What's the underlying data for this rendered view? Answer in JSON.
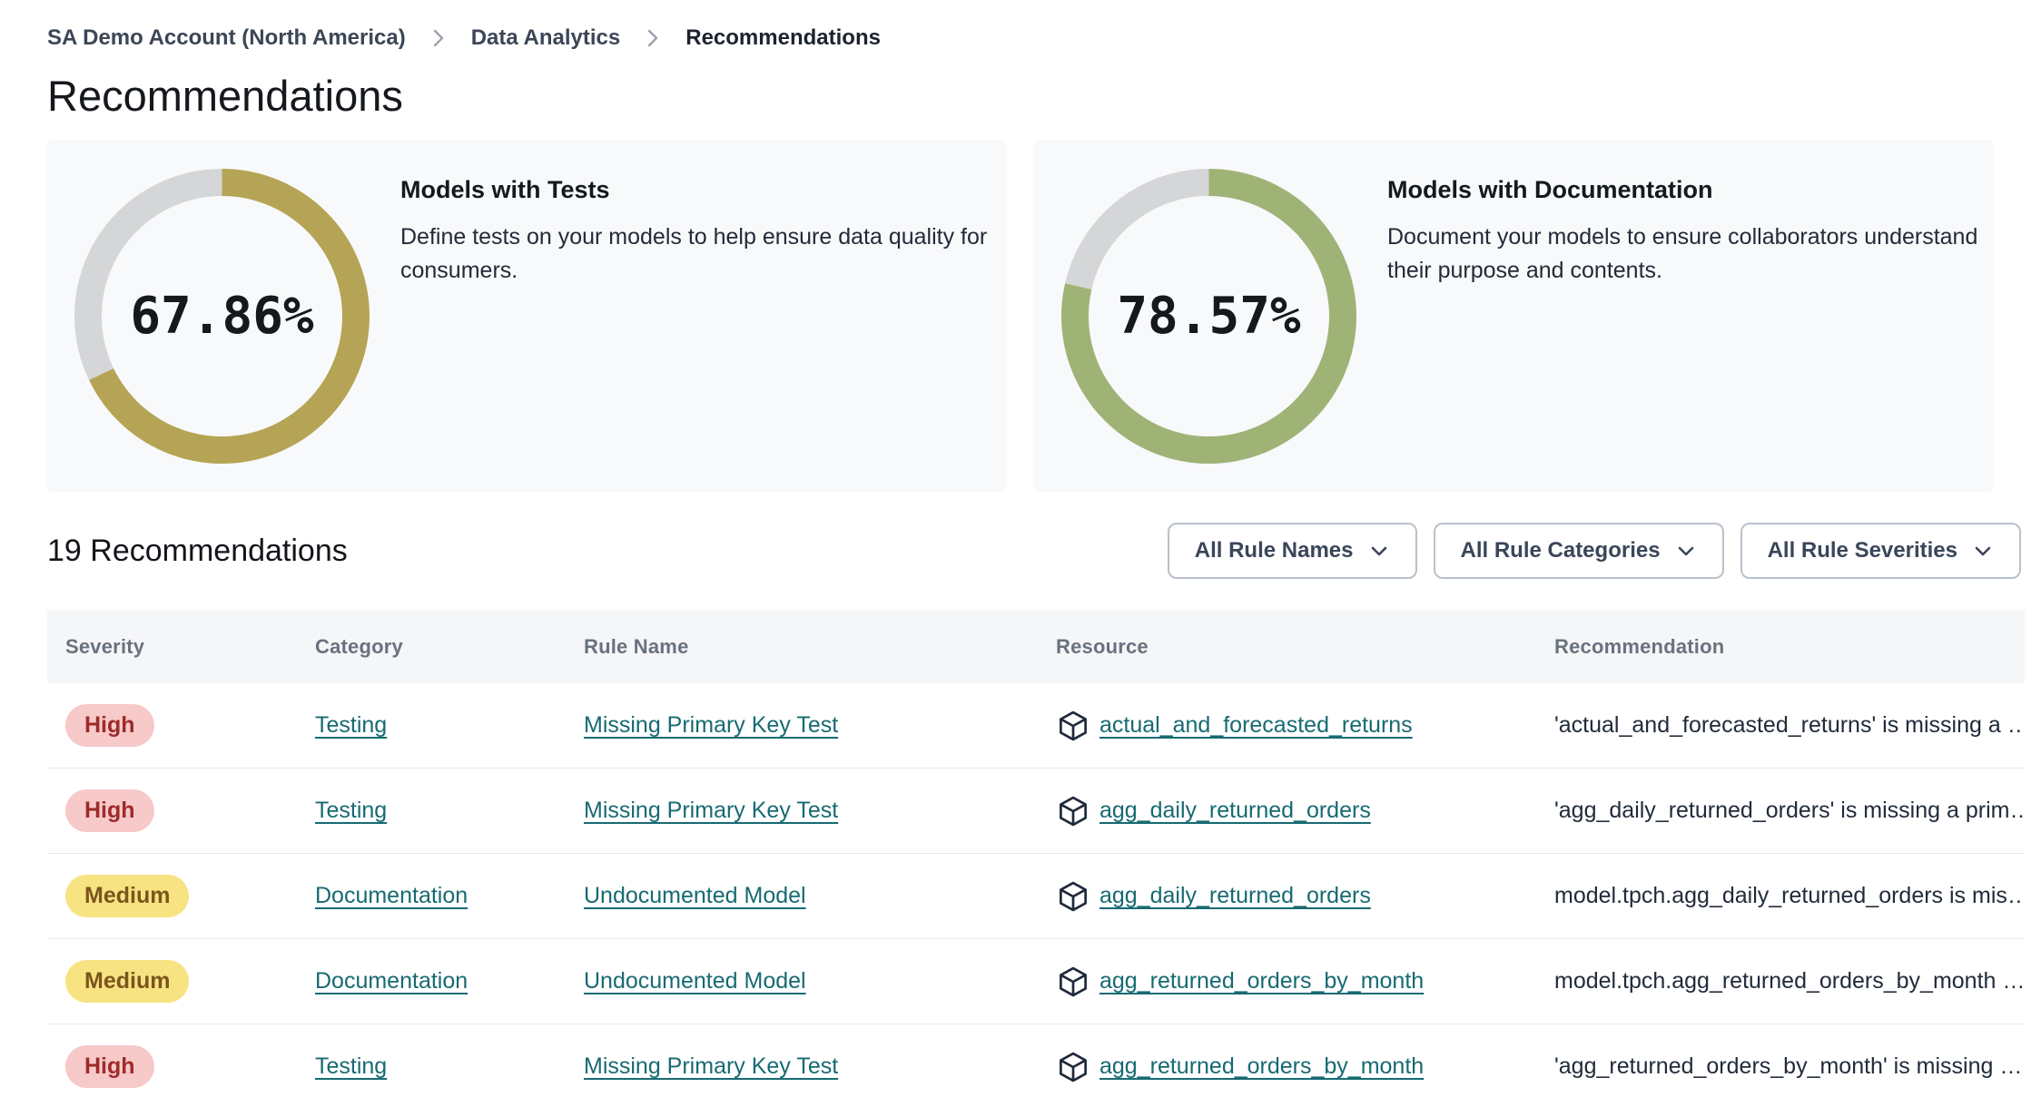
{
  "breadcrumb": {
    "items": [
      {
        "label": "SA Demo Account (North America)"
      },
      {
        "label": "Data Analytics"
      },
      {
        "label": "Recommendations"
      }
    ]
  },
  "page": {
    "title": "Recommendations"
  },
  "cards": [
    {
      "title": "Models with Tests",
      "description": "Define tests on your models to help ensure data quality for consumers.",
      "percent": 67.86,
      "percent_label": "67.86%",
      "ring_color": "#b5a455",
      "track_color": "#d5d6d7"
    },
    {
      "title": "Models with Documentation",
      "description": "Document your models to ensure collaborators understand their purpose and contents.",
      "percent": 78.57,
      "percent_label": "78.57%",
      "ring_color": "#9fb377",
      "track_color": "#d5d6d7"
    }
  ],
  "list_header": {
    "title": "19 Recommendations",
    "filters": [
      {
        "label": "All Rule Names"
      },
      {
        "label": "All Rule Categories"
      },
      {
        "label": "All Rule Severities"
      }
    ]
  },
  "table": {
    "columns": [
      "Severity",
      "Category",
      "Rule Name",
      "Resource",
      "Recommendation"
    ],
    "rows": [
      {
        "severity": "High",
        "category": "Testing",
        "rule_name": "Missing Primary Key Test",
        "resource": "actual_and_forecasted_returns",
        "recommendation": "'actual_and_forecasted_returns' is missing a …"
      },
      {
        "severity": "High",
        "category": "Testing",
        "rule_name": "Missing Primary Key Test",
        "resource": "agg_daily_returned_orders",
        "recommendation": "'agg_daily_returned_orders' is missing a prim…"
      },
      {
        "severity": "Medium",
        "category": "Documentation",
        "rule_name": "Undocumented Model",
        "resource": "agg_daily_returned_orders",
        "recommendation": "model.tpch.agg_daily_returned_orders is mis…"
      },
      {
        "severity": "Medium",
        "category": "Documentation",
        "rule_name": "Undocumented Model",
        "resource": "agg_returned_orders_by_month",
        "recommendation": "model.tpch.agg_returned_orders_by_month …"
      },
      {
        "severity": "High",
        "category": "Testing",
        "rule_name": "Missing Primary Key Test",
        "resource": "agg_returned_orders_by_month",
        "recommendation": "'agg_returned_orders_by_month' is missing …"
      }
    ]
  },
  "colors": {
    "link": "#176a72",
    "severity": {
      "High": {
        "bg": "#f8c9c9",
        "text": "#9d2b2b"
      },
      "Medium": {
        "bg": "#f8e383",
        "text": "#7a551c"
      }
    }
  }
}
